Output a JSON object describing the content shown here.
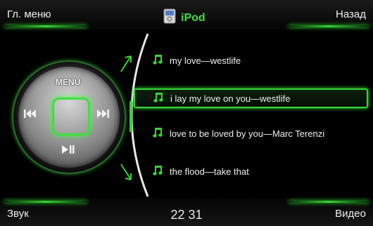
{
  "header": {
    "menu_label": "Гл. меню",
    "title": "iPod",
    "back_label": "Назад"
  },
  "footer": {
    "sound_label": "Звук",
    "clock": "22 31",
    "video_label": "Видео"
  },
  "wheel": {
    "menu_label": "MENU",
    "prev_icon": "prev-track-icon",
    "next_icon": "next-track-icon",
    "play_icon": "play-pause-icon"
  },
  "playlist": {
    "items": [
      {
        "label": "my love—westlife",
        "selected": false
      },
      {
        "label": "i lay my love on you—westlife",
        "selected": true
      },
      {
        "label": "love to be loved by you—Marc Terenzi",
        "selected": false
      },
      {
        "label": "the flood—take that",
        "selected": false
      }
    ]
  },
  "colors": {
    "accent": "#39d339",
    "background": "#000000",
    "text": "#f0f0f0"
  }
}
